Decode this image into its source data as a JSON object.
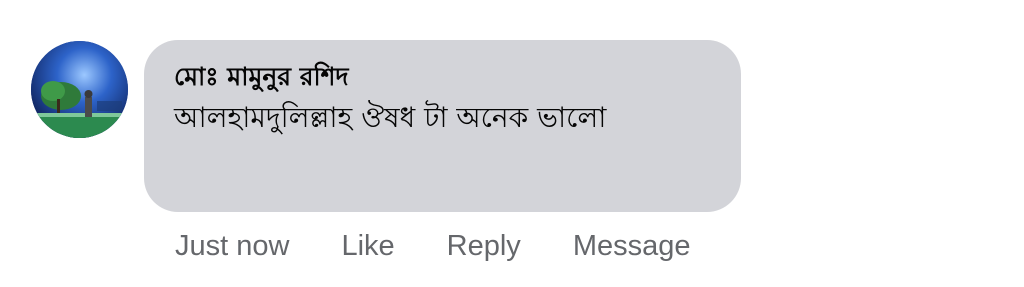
{
  "comment": {
    "author": "মোঃ মামুনুর রশিদ",
    "text": "আলহামদুলিল্লাহ ঔষধ টা অনেক ভালো",
    "avatar_icon": "user-avatar-photo",
    "bubble_color": "#d3d4d9"
  },
  "actions": {
    "timestamp": "Just now",
    "like_label": "Like",
    "reply_label": "Reply",
    "message_label": "Message",
    "color": "#65676b"
  }
}
